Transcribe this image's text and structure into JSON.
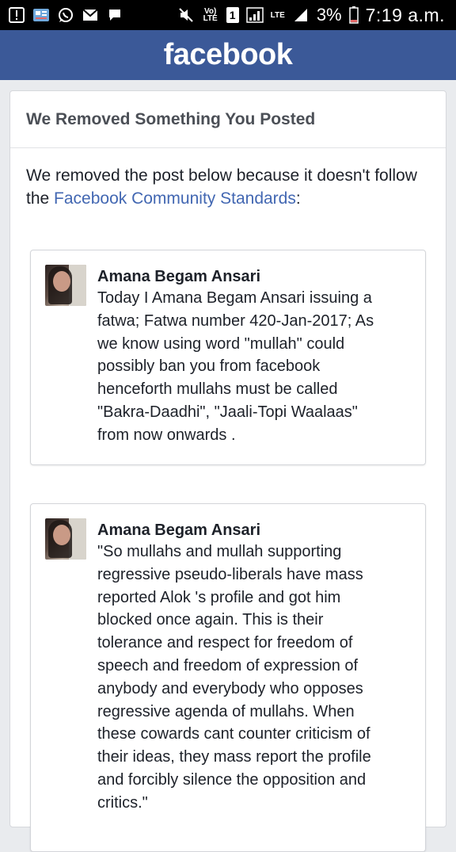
{
  "status_bar": {
    "icons_left": [
      "alert-icon",
      "news-icon",
      "whatsapp-icon",
      "mail-icon",
      "chat-bubble-icon"
    ],
    "icons_right": [
      "mute-icon",
      "volte-icon",
      "sim-icon",
      "signal-icon",
      "lte-signal-icon",
      "battery-icon"
    ],
    "volte_text": "Vo) LTE",
    "sim_text": "1",
    "lte_text": "LTE",
    "battery_pct": "3%",
    "time": "7:19 a.m."
  },
  "header": {
    "logo_text": "facebook"
  },
  "card": {
    "title": "We Removed Something You Posted",
    "intro_before": "We removed the post below because it doesn't follow the ",
    "intro_link": "Facebook Community Standards",
    "intro_after": ":"
  },
  "posts": [
    {
      "author": "Amana Begam Ansari",
      "text": "Today I Amana Begam Ansari issuing a\nfatwa; Fatwa number 420-Jan-2017; As\nwe know using word \"mullah\" could\npossibly ban you from facebook\nhenceforth mullahs must be called\n\"Bakra-Daadhi\", \"Jaali-Topi Waalaas\"\nfrom now onwards ."
    },
    {
      "author": "Amana Begam Ansari",
      "text": "\"So mullahs and mullah supporting\nregressive pseudo-liberals have mass\nreported Alok 's profile and got him\nblocked once again. This is their\ntolerance and respect for freedom of\nspeech and freedom of expression of\nanybody and everybody who opposes\nregressive agenda of mullahs. When\nthese cowards cant counter criticism of\ntheir ideas, they mass report the profile\nand forcibly silence the opposition and\ncritics.\""
    }
  ]
}
